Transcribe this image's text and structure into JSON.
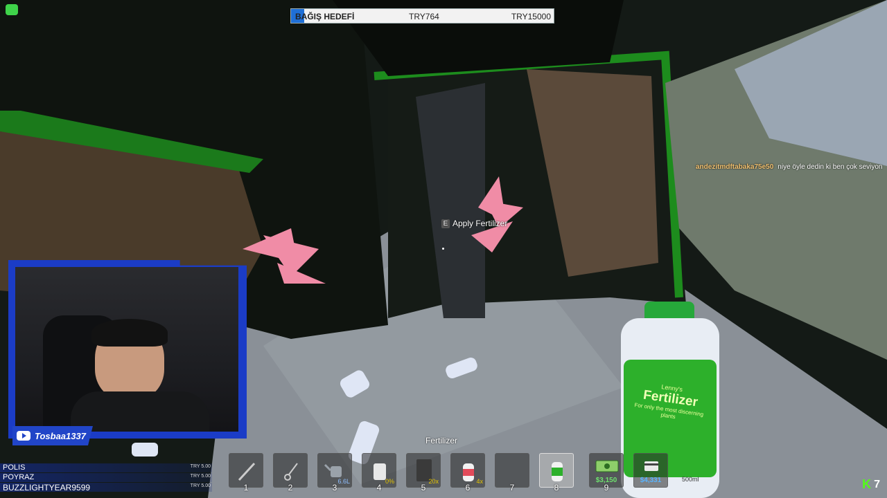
{
  "donation": {
    "label": "BAĞIŞ HEDEFİ",
    "current": "TRY764",
    "goal": "TRY15000",
    "progress": 0.051
  },
  "prompt": {
    "key": "E",
    "label": "Apply Fertilizer"
  },
  "chat": {
    "user": "andezitmdftabaka75e50",
    "message": "niye öyle dedin ki ben çok seviyon"
  },
  "streamer": {
    "channel": "Tosbaa1337"
  },
  "donors": [
    {
      "name": "POLIS",
      "amount": "TRY 5.00"
    },
    {
      "name": "POYRAZ",
      "amount": "TRY 5.00"
    },
    {
      "name": "BUZZLIGHTYEAR9599",
      "amount": "TRY 5.00"
    }
  ],
  "bottle": {
    "brand": "Lenny's",
    "name": "Fertilizer",
    "tagline": "For only the most discerning plants",
    "volume": "500ml"
  },
  "hotbar": {
    "selected_label": "Fertilizer",
    "slots": [
      {
        "num": "1",
        "qty": ""
      },
      {
        "num": "2",
        "qty": ""
      },
      {
        "num": "3",
        "qty": "6.6L"
      },
      {
        "num": "4",
        "qty": "0%"
      },
      {
        "num": "5",
        "qty": "20x"
      },
      {
        "num": "6",
        "qty": "4x"
      },
      {
        "num": "7",
        "qty": ""
      },
      {
        "num": "8",
        "qty": ""
      },
      {
        "num": "9",
        "qty": "$3,150"
      },
      {
        "num": "",
        "qty": "$4,331"
      }
    ]
  },
  "kick": {
    "viewers": "7"
  },
  "colors": {
    "accent": "#1f6fd6",
    "cam_frame": "#1b3cc6",
    "money": "#6ee06e"
  }
}
